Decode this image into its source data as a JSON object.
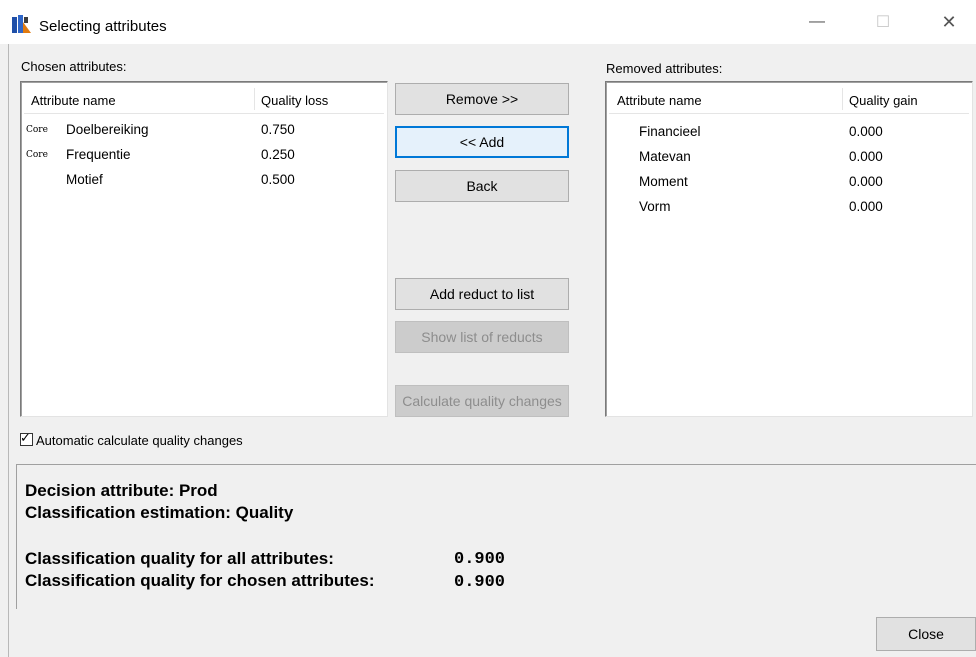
{
  "window": {
    "title": "Selecting attributes",
    "controls": {
      "minimize": "—",
      "maximize": "☐",
      "close": "✕"
    }
  },
  "chosen": {
    "label": "Chosen attributes:",
    "columns": [
      "Attribute name",
      "Quality loss"
    ],
    "rows": [
      {
        "tag": "Core",
        "name": "Doelbereiking",
        "value": "0.750"
      },
      {
        "tag": "Core",
        "name": "Frequentie",
        "value": "0.250"
      },
      {
        "tag": "",
        "name": "Motief",
        "value": "0.500"
      }
    ]
  },
  "removed": {
    "label": "Removed attributes:",
    "columns": [
      "Attribute name",
      "Quality gain"
    ],
    "rows": [
      {
        "name": "Financieel",
        "value": "0.000"
      },
      {
        "name": "Matevan",
        "value": "0.000"
      },
      {
        "name": "Moment",
        "value": "0.000"
      },
      {
        "name": "Vorm",
        "value": "0.000"
      }
    ]
  },
  "buttons": {
    "remove": "Remove >>",
    "add": "<< Add",
    "back": "Back",
    "add_reduct": "Add reduct to list",
    "show_reducts": "Show list of reducts",
    "calc_quality": "Calculate quality changes",
    "close": "Close"
  },
  "auto_calc": {
    "label": "Automatic calculate quality changes",
    "checked": true
  },
  "info": {
    "decision": "Decision attribute: Prod",
    "estimation": "Classification estimation:  Quality",
    "quality_all_label": "Classification quality for all attributes:",
    "quality_all_value": "0.900",
    "quality_chosen_label": "Classification quality for chosen attributes:",
    "quality_chosen_value": "0.900"
  }
}
